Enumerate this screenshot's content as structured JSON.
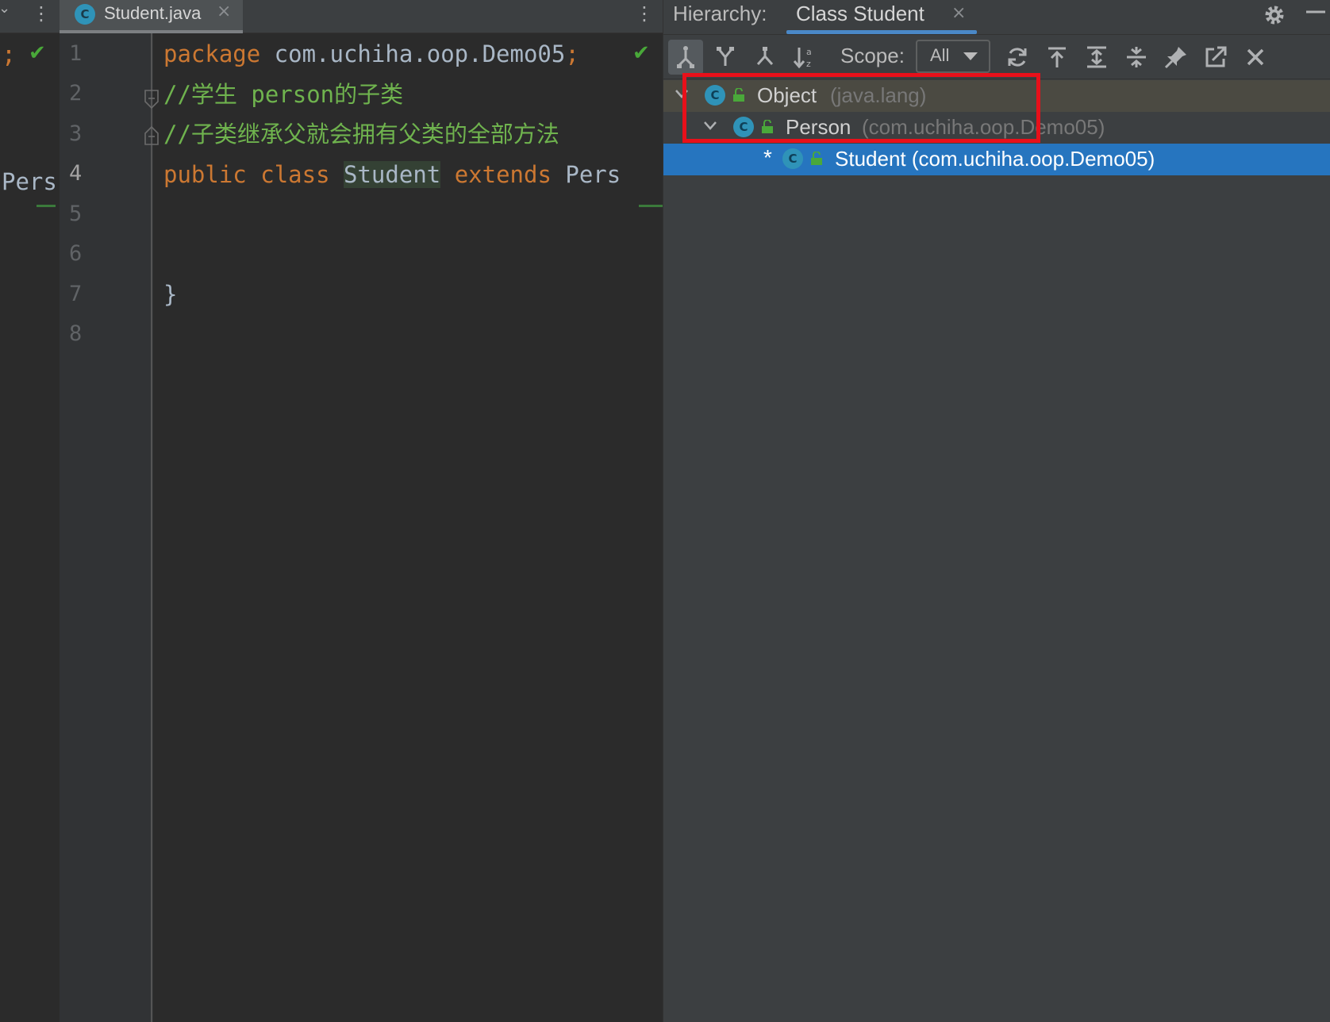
{
  "left_strip": {
    "semicolon": ";",
    "fragment": "Pers"
  },
  "editor": {
    "tab": {
      "label": "Student.java",
      "icon_letter": "C"
    },
    "lines": [
      {
        "num": "1"
      },
      {
        "num": "2"
      },
      {
        "num": "3"
      },
      {
        "num": "4"
      },
      {
        "num": "5"
      },
      {
        "num": "6"
      },
      {
        "num": "7"
      },
      {
        "num": "8"
      }
    ],
    "code": {
      "l1_kw": "package",
      "l1_rest": " com.uchiha.oop.Demo05",
      "l1_semi": ";",
      "l2": "//学生  person的子类",
      "l3": "//子类继承父就会拥有父类的全部方法",
      "l4_public": "public",
      "l4_class": "class",
      "l4_name": "Student",
      "l4_extends": "extends",
      "l4_super": "Pers",
      "l7": "}"
    }
  },
  "hierarchy": {
    "title": "Hierarchy:",
    "tab_label": "Class Student",
    "scope_label": "Scope:",
    "scope_value": "All",
    "nodes": [
      {
        "name": "Object",
        "pkg": "(java.lang)",
        "icon_letter": "C"
      },
      {
        "name": "Person",
        "pkg": "(com.uchiha.oop.Demo05)",
        "icon_letter": "C"
      },
      {
        "name": "Student (com.uchiha.oop.Demo05)",
        "marker": "*",
        "icon_letter": "C"
      }
    ]
  },
  "colors": {
    "keyword": "#cc7832",
    "comment": "#629755",
    "selection": "#2675bf",
    "highlight_box": "#e8101a",
    "class_icon": "#2f93b8"
  }
}
